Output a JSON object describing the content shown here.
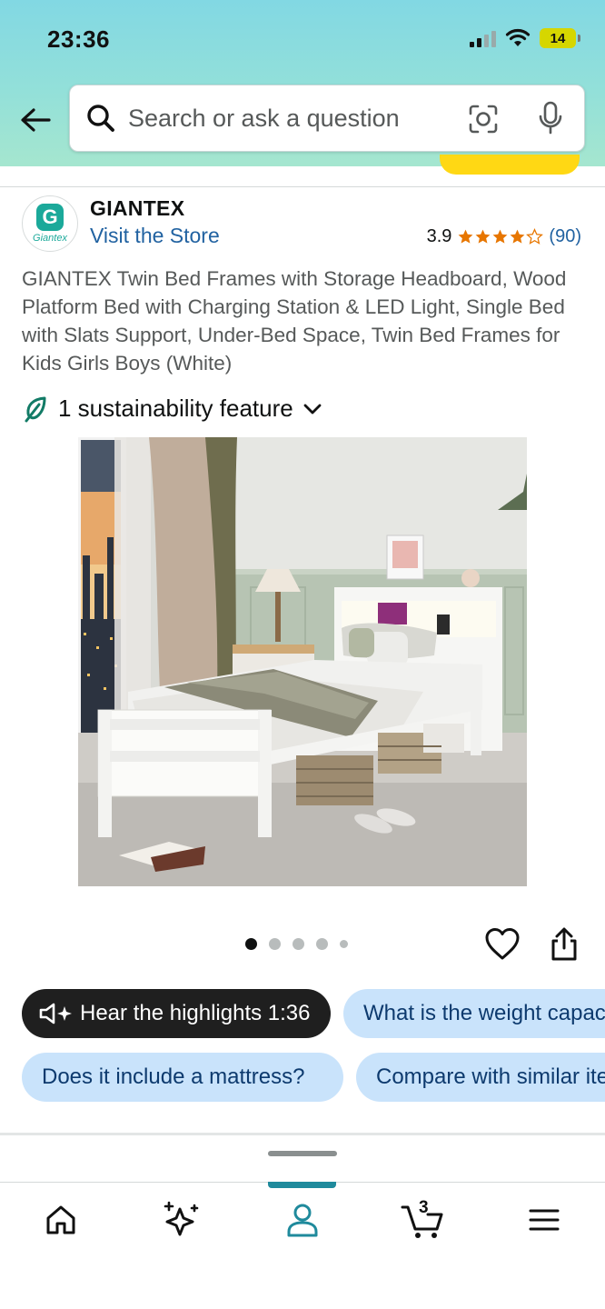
{
  "status": {
    "time": "23:36",
    "battery": "14"
  },
  "search": {
    "placeholder": "Search or ask a question"
  },
  "icons": {
    "back": "arrow-left-icon",
    "search": "magnifier-icon",
    "camera": "camera-lens-icon",
    "mic": "microphone-icon",
    "leaf": "leaf-icon",
    "chevron": "chevron-down-icon",
    "heart": "heart-icon",
    "share": "share-icon",
    "speaker": "speaker-sparkle-icon",
    "home": "home-icon",
    "ai": "sparkle-icon",
    "you": "person-icon",
    "cart": "cart-icon",
    "menu": "hamburger-icon"
  },
  "seller": {
    "logo_text": "Giantex",
    "name": "GIANTEX",
    "store_link": "Visit the Store",
    "rating": "3.9",
    "rating_value": 3.9,
    "rating_count": "(90)"
  },
  "product": {
    "title": "GIANTEX Twin Bed Frames with Storage Headboard, Wood Platform Bed with Charging Station & LED Light, Single Bed with Slats Support, Under-Bed Space, Twin Bed Frames for Kids Girls Boys (White)",
    "sustainability": "1 sustainability feature",
    "image_count": 5,
    "image_index": 1
  },
  "chips": {
    "hear": "Hear the highlights 1:36",
    "weight": "What is the weight capacity?",
    "mattress": "Does it include a mattress?",
    "compare": "Compare with similar items"
  },
  "nav": {
    "cart_count": "3",
    "active": "you"
  },
  "colors": {
    "header_top": "#82d8e3",
    "header_bottom": "#a5e6cf",
    "link": "#2162a1",
    "star": "#e77600",
    "chip_light": "#c9e3fb",
    "chip_dark": "#1f1f1f",
    "nav_active": "#1f8a9c",
    "teal": "#1ba99a"
  }
}
